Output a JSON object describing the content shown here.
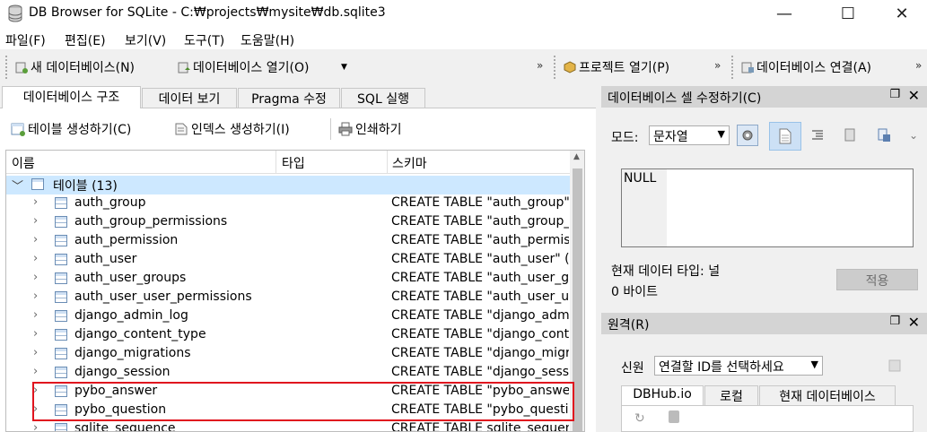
{
  "window": {
    "title": "DB Browser for SQLite - C:₩projects₩mysite₩db.sqlite3",
    "min_glyph": "—",
    "max_glyph": "☐",
    "close_glyph": "✕"
  },
  "menu": [
    "파일(F)",
    "편집(E)",
    "보기(V)",
    "도구(T)",
    "도움말(H)"
  ],
  "toolbar": {
    "new_db": "새 데이터베이스(N)",
    "open_db": "데이터베이스 열기(O)",
    "open_project": "프로젝트 열기(P)",
    "connect_db": "데이터베이스 연결(A)",
    "overflow": "»"
  },
  "tabs": [
    "데이터베이스 구조",
    "데이터 보기",
    "Pragma 수정",
    "SQL 실행"
  ],
  "structure_toolbar": {
    "create_table": "테이블 생성하기(C)",
    "create_index": "인덱스 생성하기(I)",
    "print": "인쇄하기"
  },
  "tree": {
    "columns": [
      "이름",
      "타입",
      "스키마"
    ],
    "group_label": "테이블 (13)",
    "rows": [
      {
        "name": "auth_group",
        "schema": "CREATE TABLE \"auth_group\" (\"id\" integer NOT NULL PRIMARY KEY"
      },
      {
        "name": "auth_group_permissions",
        "schema": "CREATE TABLE \"auth_group_permissions\""
      },
      {
        "name": "auth_permission",
        "schema": "CREATE TABLE \"auth_permission\""
      },
      {
        "name": "auth_user",
        "schema": "CREATE TABLE \"auth_user\" (\"id\""
      },
      {
        "name": "auth_user_groups",
        "schema": "CREATE TABLE \"auth_user_groups\""
      },
      {
        "name": "auth_user_user_permissions",
        "schema": "CREATE TABLE \"auth_user_user_permissions\""
      },
      {
        "name": "django_admin_log",
        "schema": "CREATE TABLE \"django_admin_log\""
      },
      {
        "name": "django_content_type",
        "schema": "CREATE TABLE \"django_content_type\""
      },
      {
        "name": "django_migrations",
        "schema": "CREATE TABLE \"django_migrations\""
      },
      {
        "name": "django_session",
        "schema": "CREATE TABLE \"django_session\""
      },
      {
        "name": "pybo_answer",
        "schema": "CREATE TABLE \"pybo_answer\""
      },
      {
        "name": "pybo_question",
        "schema": "CREATE TABLE \"pybo_question\""
      },
      {
        "name": "sqlite_sequence",
        "schema": "CREATE TABLE sqlite_sequence(name,seq)"
      }
    ]
  },
  "edit_cell": {
    "title": "데이터베이스 셀 수정하기(C)",
    "mode_label": "모드:",
    "mode_value": "문자열",
    "cell_value": "NULL",
    "type_info": "현재 데이터 타입: 널",
    "size_info": "0 바이트",
    "apply": "적용"
  },
  "remote": {
    "title": "원격(R)",
    "identity_label": "신원",
    "identity_value": "연결할 ID를 선택하세요",
    "tabs": [
      "DBHub.io",
      "로컬",
      "현재 데이터베이스"
    ]
  },
  "colors": {
    "highlight_box": "#e0141e",
    "selected_row": "#cde8ff",
    "dock_header": "#d4d4d4"
  }
}
